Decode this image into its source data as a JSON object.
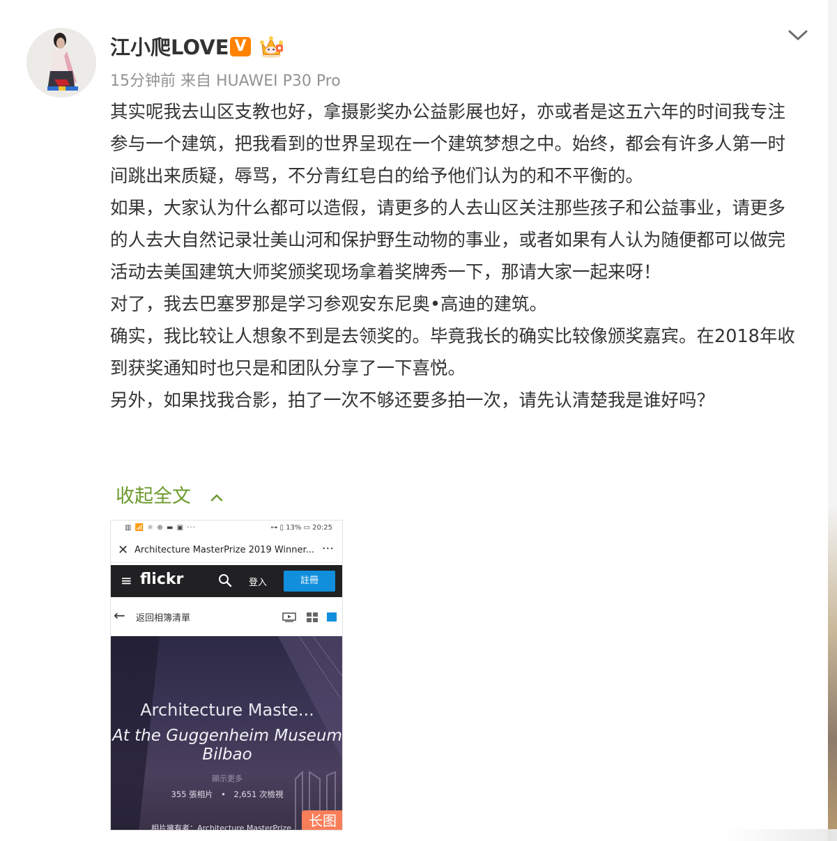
{
  "post": {
    "username": "江小爬LOVE",
    "verified_badge": "V",
    "meta": "15分钟前 来自 HUAWEI P30 Pro",
    "paragraphs": [
      "其实呢我去山区支教也好，拿摄影奖办公益影展也好，亦或者是这五六年的时间我专注参与一个建筑，把我看到的世界呈现在一个建筑梦想之中。始终，都会有许多人第一时间跳出来质疑，辱骂，不分青红皂白的给予他们认为的和不平衡的。",
      "如果，大家认为什么都可以造假，请更多的人去山区关注那些孩子和公益事业，请更多的人去大自然记录壮美山河和保护野生动物的事业，或者如果有人认为随便都可以做完活动去美国建筑大师奖颁奖现场拿着奖牌秀一下，那请大家一起来呀！",
      "对了，我去巴塞罗那是学习参观安东尼奥•高迪的建筑。",
      "确实，我比较让人想象不到是去领奖的。毕竟我长的确实比较像颁奖嘉宾。在2018年收到获奖通知时也只是和团队分享了一下喜悦。",
      "另外，如果找我合影，拍了一次不够还要多拍一次，请先认清楚我是谁好吗？"
    ],
    "collapse_label": "收起全文",
    "icons": {
      "avatar": "avatar",
      "verified": "verified-icon",
      "crown": "crown-icon",
      "collapse": "chevron-down-icon",
      "fold": "chevron-up-icon"
    },
    "colors": {
      "link_green": "#6b9a2c",
      "badge_orange": "#ff8200",
      "long_image_badge": "#f87e5a"
    }
  },
  "image": {
    "status_left": "▥ 📶 ☼ ⊕ ▬ ▣ ···",
    "status_right": "⊶ ▯ 13% ▭ 20:25",
    "page_title": "Architecture MasterPrize 2019 Winner...",
    "close_glyph": "✕",
    "more_glyph": "···",
    "brand": "flickr",
    "login": "登入",
    "signup": "註冊",
    "back_label": "返回相簿清單",
    "hero_title": "Architecture Maste...",
    "hero_subtitle": "At the Guggenheim Museum Bilbao",
    "show_more": "顯示更多",
    "stats": "355 張相片　•　2,651 次檢視",
    "owner": "相片擁有者：Architecture MasterPrize",
    "long_image_badge": "长图"
  }
}
